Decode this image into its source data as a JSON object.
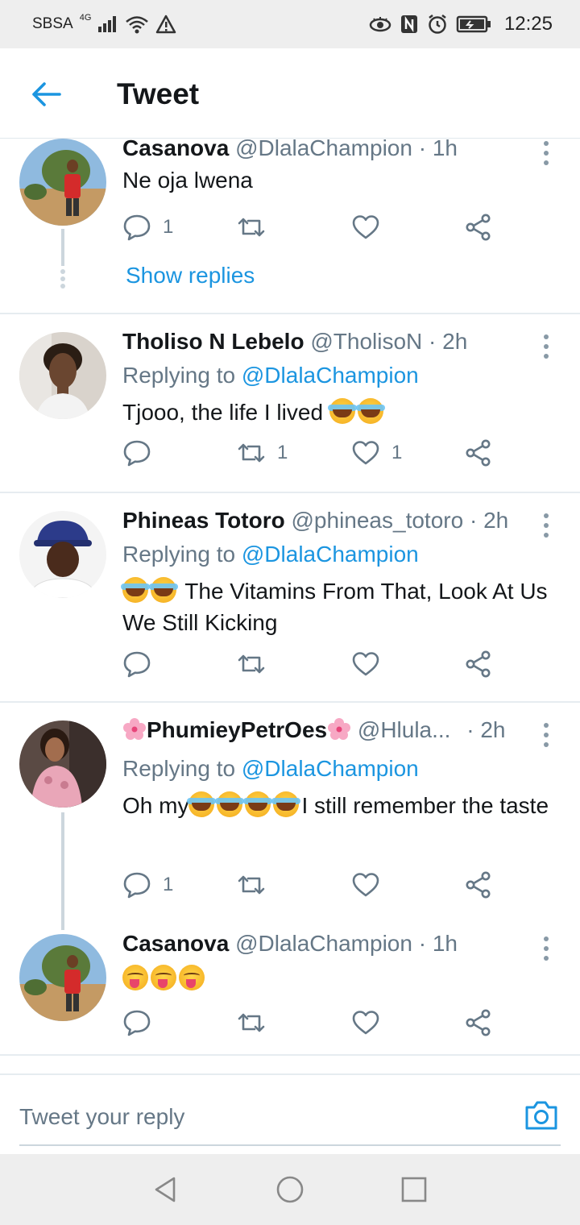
{
  "status_bar": {
    "carrier": "SBSA",
    "network": "4G",
    "time": "12:25",
    "icons": [
      "signal-icon",
      "wifi-icon",
      "warning-icon",
      "eye-icon",
      "nfc-icon",
      "alarm-icon",
      "battery-icon"
    ]
  },
  "header": {
    "title": "Tweet",
    "back_icon": "arrow-left-icon"
  },
  "colors": {
    "accent": "#1b95e0",
    "text_primary": "#14171a",
    "text_secondary": "#657786",
    "divider": "#e6ecf0"
  },
  "tweets": [
    {
      "name": "Casanova",
      "handle": "@DlalaChampion",
      "time": "· 1h",
      "replying_label": "",
      "replying_to": "",
      "text": "Ne oja lwena",
      "reply_count": "1",
      "retweet_count": "",
      "like_count": "",
      "show_replies": "Show replies"
    },
    {
      "name": "Tholiso N Lebelo",
      "handle": "@TholisoN",
      "time": "· 2h",
      "replying_label": "Replying to ",
      "replying_to": "@DlalaChampion",
      "text": "Tjooo, the life I lived",
      "text_emojis": [
        "face-with-tears-of-joy",
        "face-with-tears-of-joy"
      ],
      "reply_count": "",
      "retweet_count": "1",
      "like_count": "1"
    },
    {
      "name": "Phineas Totoro",
      "handle": "@phineas_totoro",
      "time": "· 2h",
      "replying_label": "Replying to ",
      "replying_to": "@DlalaChampion",
      "text_emojis": [
        "face-with-tears-of-joy",
        "face-with-tears-of-joy"
      ],
      "text": "The Vitamins From That, Look At Us We Still Kicking",
      "reply_count": "",
      "retweet_count": "",
      "like_count": ""
    },
    {
      "name": "PhumieyPetrOes",
      "name_emojis": [
        "cherry-blossom",
        "cherry-blossom"
      ],
      "handle": "@Hlula...",
      "time": "· 2h",
      "replying_label": "Replying to ",
      "replying_to": "@DlalaChampion",
      "text_before": "Oh my",
      "text_emojis": [
        "loudly-crying-face",
        "loudly-crying-face",
        "loudly-crying-face",
        "loudly-crying-face"
      ],
      "text": "I still remember the taste",
      "reply_count": "1",
      "retweet_count": "",
      "like_count": ""
    },
    {
      "name": "Casanova",
      "handle": "@DlalaChampion",
      "time": "· 1h",
      "text_emojis": [
        "face-savoring-food",
        "face-savoring-food",
        "face-savoring-food"
      ],
      "reply_count": "",
      "retweet_count": "",
      "like_count": ""
    }
  ],
  "reply_bar": {
    "placeholder": "Tweet your reply",
    "camera_icon": "camera-icon"
  },
  "nav_bar": {
    "buttons": [
      "back-triangle-icon",
      "home-circle-icon",
      "recents-square-icon"
    ]
  }
}
